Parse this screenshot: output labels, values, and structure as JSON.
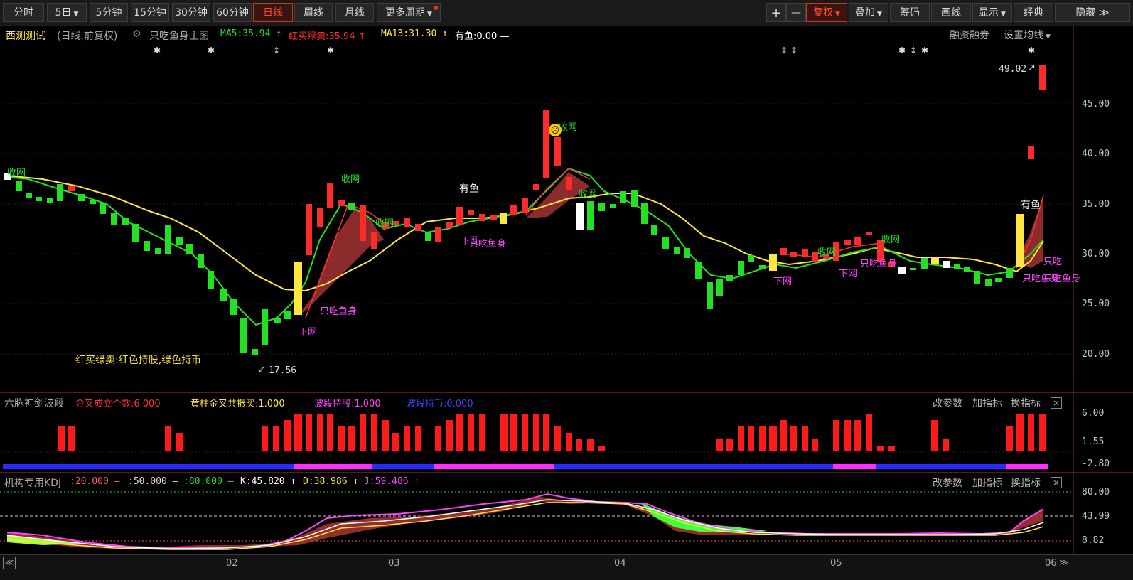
{
  "toolbar": {
    "left": [
      "分时",
      "5日",
      "5分钟",
      "15分钟",
      "30分钟",
      "60分钟",
      "日线",
      "周线",
      "月线",
      "更多周期"
    ],
    "active": "日线",
    "right": [
      "复权",
      "叠加",
      "筹码",
      "画线",
      "显示",
      "经典",
      "隐藏"
    ],
    "plus": "+",
    "minus": "—",
    "more_arrow": "≫"
  },
  "main": {
    "stock_name": "西测测试",
    "period_mode": "(日线,前复权)",
    "indicator_name": "只吃鱼身主图",
    "ma5": "MA5:35.94 ↑",
    "hongmai": "红买绿卖:35.94 ↑",
    "ma13": "MA13:31.30 ↑",
    "youyu": "有鱼:0.00 —",
    "finance_link": "融资融券",
    "ma_settings": "设置均线",
    "price_axis": [
      "45.00",
      "40.00",
      "35.00",
      "30.00",
      "25.00",
      "20.00"
    ],
    "high_marker": "49.02",
    "low_marker": "17.56",
    "note": "红买绿卖:红色持股,绿色持币",
    "annotations": [
      "收网",
      "收网",
      "收网",
      "收网",
      "收网",
      "收网",
      "收网",
      "有鱼",
      "有鱼",
      "下网",
      "下网",
      "下网",
      "下网",
      "只吃鱼身",
      "只吃鱼身",
      "只吃鱼身",
      "只吃鱼身",
      "只吃",
      "只吃鱼身"
    ]
  },
  "liumai": {
    "title": "六脉神剑波段",
    "jincha": "金叉成立个数:6.000 —",
    "huangzhu": "黄柱金叉共振买:1.000 —",
    "boduan_chi": "波段持股:1.000 —",
    "boduan_bi": "波段持币:0.000 —",
    "axis": [
      "6.00",
      "1.55",
      "-2.80"
    ],
    "buttons": [
      "改参数",
      "加指标",
      "换指标"
    ],
    "close": "×"
  },
  "kdj": {
    "title": "机构专用KDJ",
    "l20": ":20.000 —",
    "l50": ":50.000 —",
    "l80": ":80.000 —",
    "k": "K:45.820 ↑",
    "d": "D:38.986 ↑",
    "j": "J:59.486 ↑",
    "axis": [
      "80.00",
      "43.99",
      "8.82"
    ],
    "buttons": [
      "改参数",
      "加指标",
      "换指标"
    ],
    "close": "×"
  },
  "dates": [
    "02",
    "03",
    "04",
    "05",
    "06"
  ],
  "colors": {
    "up": "#ff2a2a",
    "down": "#22e022",
    "ma5": "#22e022",
    "ma13": "#ffe640",
    "yellow": "#ffe640",
    "magenta": "#ff40ff",
    "blue": "#2a2aff",
    "white": "#ffffff",
    "fill": "#9a3030"
  }
}
